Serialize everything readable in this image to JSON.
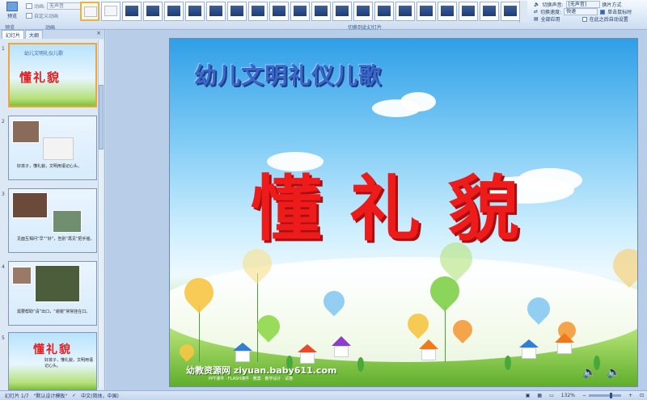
{
  "ribbon": {
    "preview_label": "预览",
    "preview_group": "预览",
    "sound_label": "无声音",
    "custom_anim": "自定义动画",
    "animation_group": "动画",
    "transition_group": "切换到此幻灯片",
    "transition_sound_label": "切换声音:",
    "transition_sound_value": "[无声音]",
    "transition_speed_label": "切换速度:",
    "transition_speed_value": "快速",
    "apply_all": "全部应用",
    "switch_mode": "换片方式",
    "on_click": "单击鼠标时",
    "auto_after": "在此之后自动设置"
  },
  "panel": {
    "tab_slides": "幻灯片",
    "tab_outline": "大纲",
    "close": "×",
    "thumbs": [
      {
        "num": "1",
        "title": "懂礼貌",
        "subtitle": "幼儿文明礼仪儿歌",
        "caption": ""
      },
      {
        "num": "2",
        "title": "",
        "subtitle": "",
        "caption": "好孩子，懂礼貌，文明用语记心头。"
      },
      {
        "num": "3",
        "title": "",
        "subtitle": "",
        "caption": "见面互相问“早”“好”，告别“再见”把手摇。"
      },
      {
        "num": "4",
        "title": "",
        "subtitle": "",
        "caption": "需要帮助“请”出口，“谢谢”常常挂在口。"
      },
      {
        "num": "5",
        "title": "懂礼貌",
        "subtitle": "",
        "caption": "好孩子，懂礼貌，文明用语记心头。"
      }
    ]
  },
  "slide": {
    "subtitle": "幼儿文明礼仪儿歌",
    "title": "懂礼貌",
    "footer": "幼教资源网 ziyuan.baby611.com",
    "footer_sub": "PPT课件 · FLASH课件 · 教案 · 教学设计 · 试卷"
  },
  "status": {
    "slide_info": "幻灯片 1/7",
    "theme": "\"默认设计模板\"",
    "language": "中文(简体，中国)",
    "zoom": "132%"
  }
}
